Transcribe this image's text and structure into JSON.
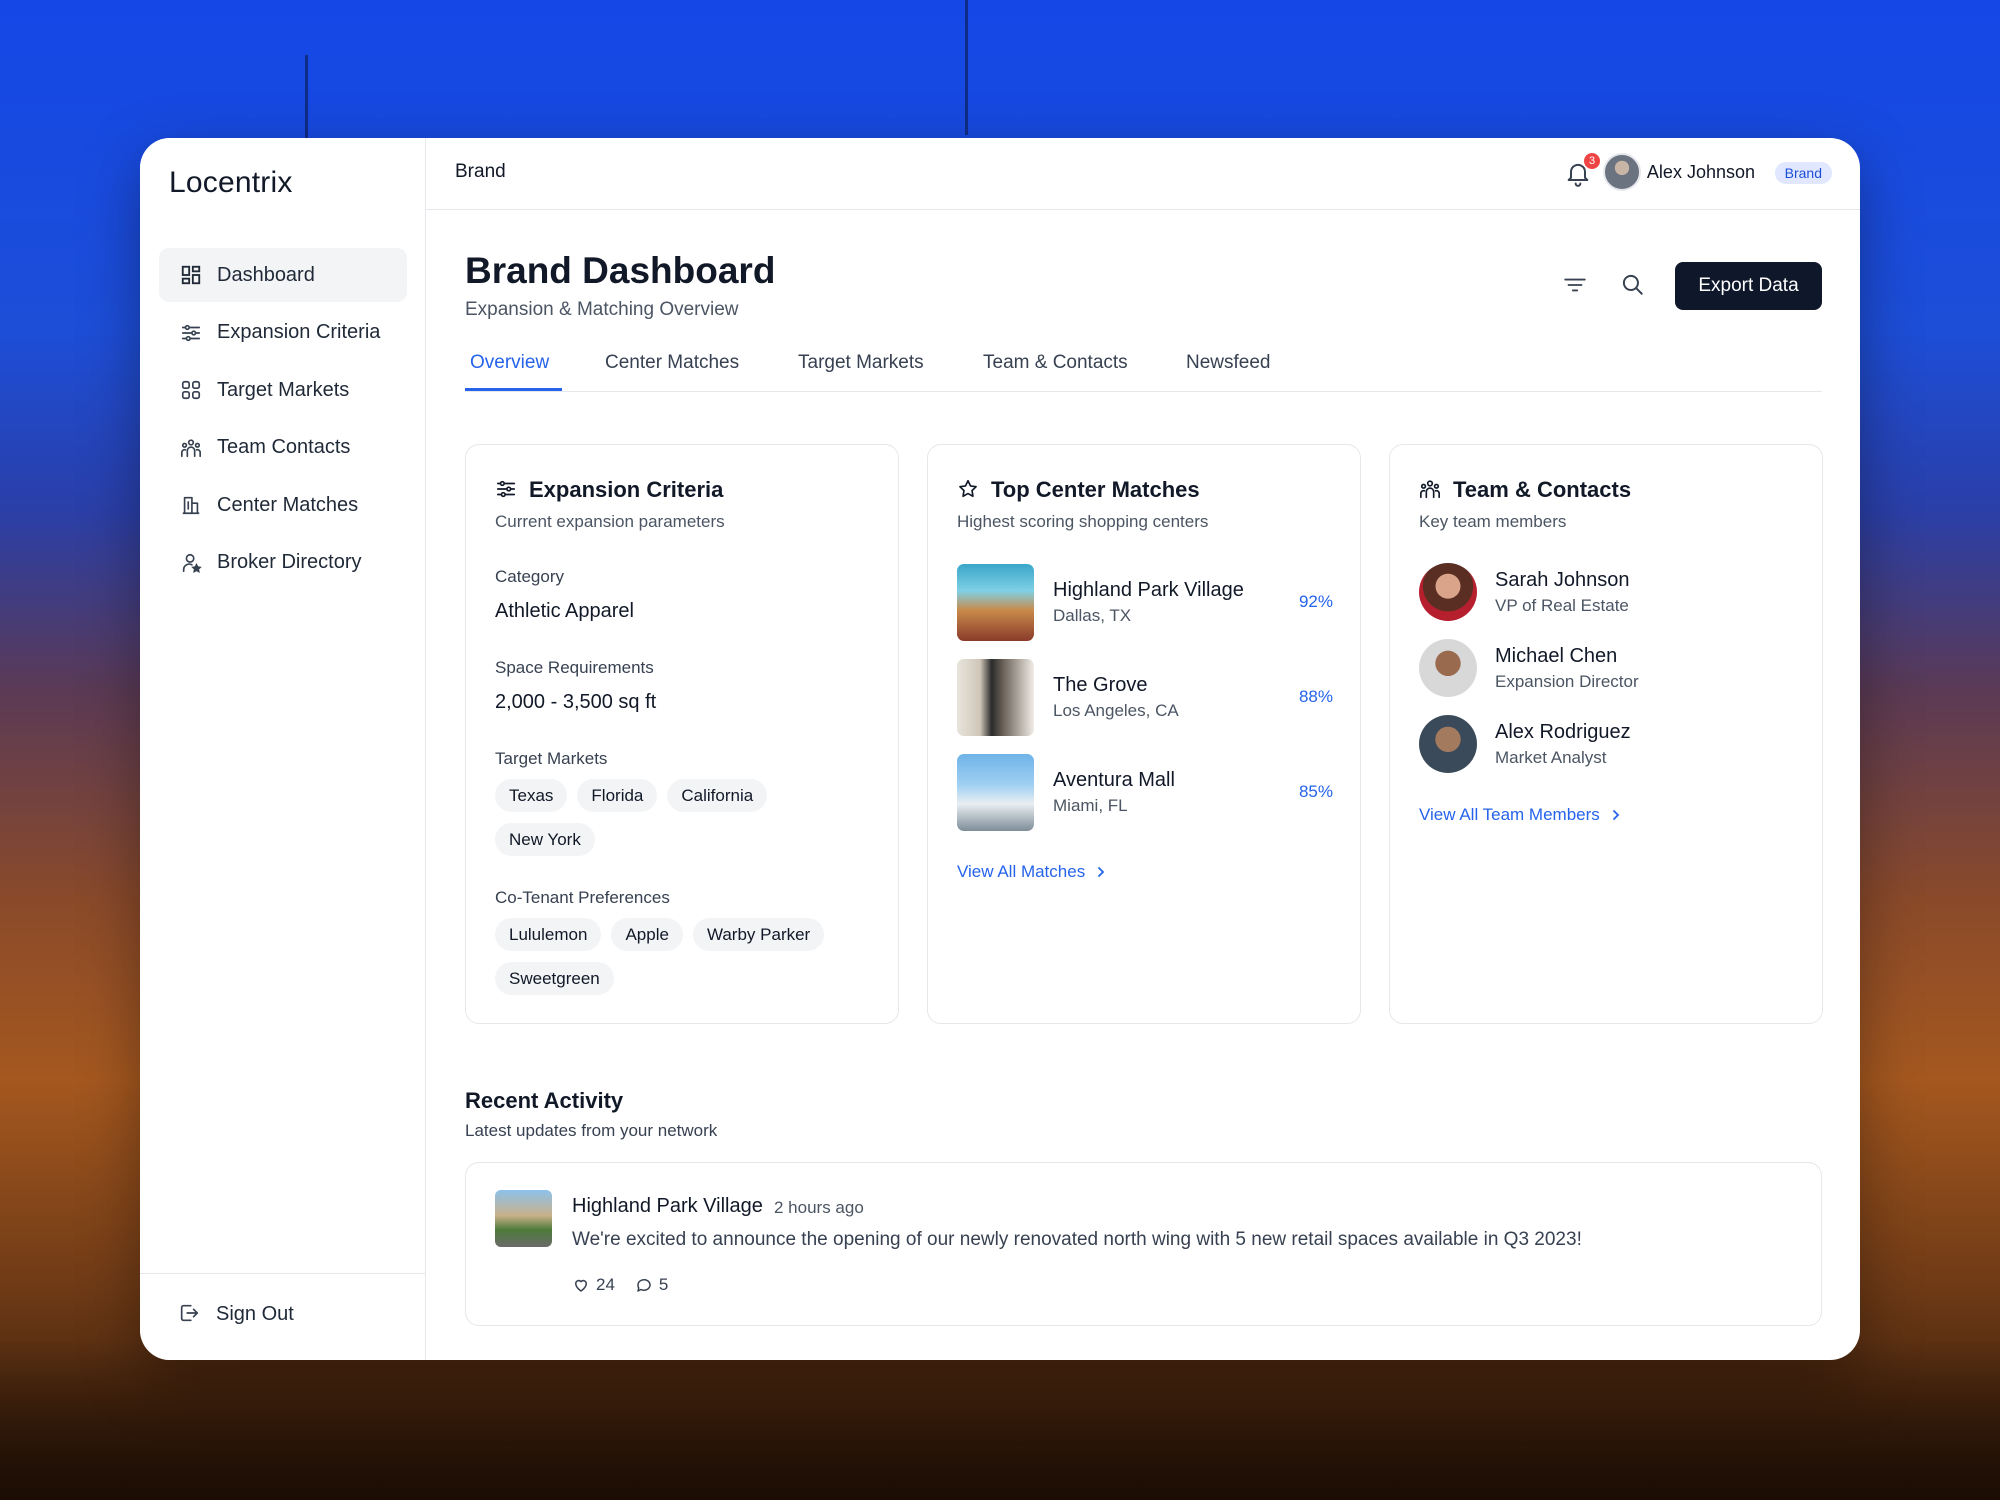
{
  "app": {
    "name": "Locentrix"
  },
  "sidebar": {
    "items": [
      {
        "label": "Dashboard",
        "icon": "dashboard-icon",
        "active": true
      },
      {
        "label": "Expansion Criteria",
        "icon": "sliders-icon"
      },
      {
        "label": "Target Markets",
        "icon": "grid-icon"
      },
      {
        "label": "Team Contacts",
        "icon": "users-icon"
      },
      {
        "label": "Center Matches",
        "icon": "building-icon"
      },
      {
        "label": "Broker Directory",
        "icon": "user-star-icon"
      }
    ],
    "sign_out": "Sign Out"
  },
  "topbar": {
    "breadcrumb": "Brand",
    "notification_count": "3",
    "user_name": "Alex Johnson",
    "user_role": "Brand"
  },
  "page": {
    "title": "Brand Dashboard",
    "subtitle": "Expansion & Matching Overview",
    "export_label": "Export Data"
  },
  "tabs": [
    {
      "label": "Overview",
      "active": true
    },
    {
      "label": "Center Matches"
    },
    {
      "label": "Target Markets"
    },
    {
      "label": "Team & Contacts"
    },
    {
      "label": "Newsfeed"
    }
  ],
  "expansion": {
    "title": "Expansion Criteria",
    "subtitle": "Current expansion parameters",
    "category_label": "Category",
    "category_value": "Athletic Apparel",
    "space_label": "Space Requirements",
    "space_value": "2,000 - 3,500 sq ft",
    "markets_label": "Target Markets",
    "markets": [
      "Texas",
      "Florida",
      "California",
      "New York"
    ],
    "cotenant_label": "Co-Tenant Preferences",
    "cotenants": [
      "Lululemon",
      "Apple",
      "Warby Parker",
      "Sweetgreen"
    ]
  },
  "matches": {
    "title": "Top Center Matches",
    "subtitle": "Highest scoring shopping centers",
    "items": [
      {
        "name": "Highland Park Village",
        "location": "Dallas, TX",
        "score": "92%"
      },
      {
        "name": "The Grove",
        "location": "Los Angeles, CA",
        "score": "88%"
      },
      {
        "name": "Aventura Mall",
        "location": "Miami, FL",
        "score": "85%"
      }
    ],
    "link": "View All Matches"
  },
  "team": {
    "title": "Team & Contacts",
    "subtitle": "Key team members",
    "members": [
      {
        "name": "Sarah Johnson",
        "role": "VP of Real Estate"
      },
      {
        "name": "Michael Chen",
        "role": "Expansion Director"
      },
      {
        "name": "Alex Rodriguez",
        "role": "Market Analyst"
      }
    ],
    "link": "View All Team Members"
  },
  "activity": {
    "title": "Recent Activity",
    "subtitle": "Latest updates from your network",
    "items": [
      {
        "name": "Highland Park Village",
        "time": "2 hours ago",
        "text": "We're excited to announce the opening of our newly renovated north wing with 5 new retail spaces available in Q3 2023!",
        "likes": "24",
        "comments": "5"
      }
    ]
  },
  "colors": {
    "accent": "#2563eb",
    "primary_button": "#0f172a",
    "badge": "#ef4444"
  }
}
